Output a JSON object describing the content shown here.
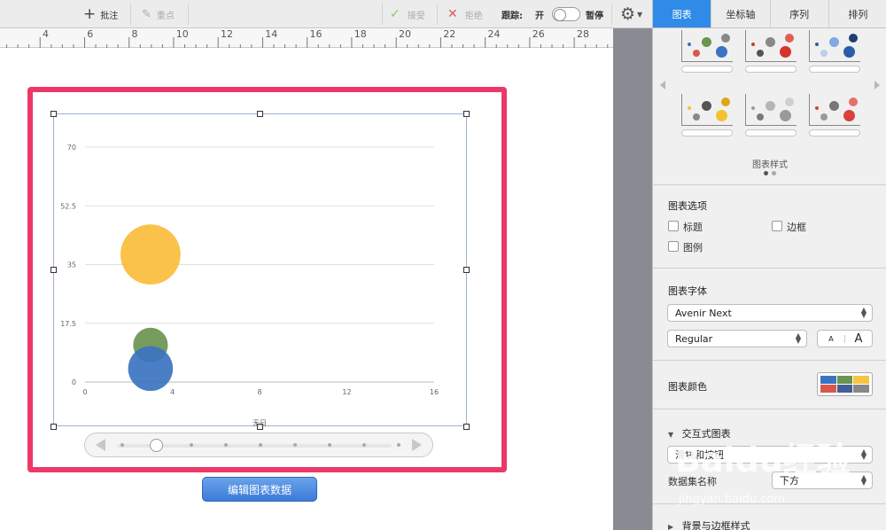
{
  "toolbar": {
    "comment_label": "批注",
    "highlight_label": "重点",
    "accept_label": "接受",
    "reject_label": "拒绝",
    "track_label": "跟踪:",
    "track_on_label": "开",
    "pause_label": "暂停"
  },
  "ruler": {
    "labels": [
      "4",
      "6",
      "8",
      "10",
      "12",
      "14",
      "16",
      "18",
      "20",
      "22",
      "24",
      "26",
      "28"
    ]
  },
  "chart_data": {
    "type": "scatter",
    "variant": "bubble",
    "xlabel": "无日",
    "x_ticks": [
      "0",
      "4",
      "8",
      "12",
      "16"
    ],
    "y_ticks": [
      "0",
      "17.5",
      "35",
      "52.5",
      "70"
    ],
    "xlim": [
      0,
      16
    ],
    "ylim": [
      0,
      70
    ],
    "grid": true,
    "legend": "none",
    "series": [
      {
        "color": "#fbbd3c",
        "points": [
          {
            "x": 3,
            "y": 38,
            "size": 9
          }
        ]
      },
      {
        "color": "#6a9450",
        "points": [
          {
            "x": 3,
            "y": 11,
            "size": 3
          }
        ]
      },
      {
        "color": "#3b74c0",
        "points": [
          {
            "x": 3,
            "y": 4,
            "size": 5
          }
        ]
      }
    ]
  },
  "edit_button_label": "编辑图表数据",
  "inspector": {
    "tabs": [
      {
        "label": "图表"
      },
      {
        "label": "坐标轴"
      },
      {
        "label": "序列"
      },
      {
        "label": "排列"
      }
    ],
    "styles_label": "图表样式",
    "options": {
      "title": "图表选项",
      "title_checkbox": "标题",
      "border_checkbox": "边框",
      "legend_checkbox": "图例"
    },
    "font": {
      "title": "图表字体",
      "family": "Avenir Next",
      "weight": "Regular",
      "size_small": "A",
      "size_large": "A"
    },
    "colors": {
      "title": "图表颜色",
      "palette": [
        "#3a73c2",
        "#6a9450",
        "#f5c440",
        "#d9584a",
        "#3f5f96",
        "#888888"
      ]
    },
    "interactive": {
      "title": "交互式图表",
      "mode": "滑块和按钮",
      "data_label": "数据集名称",
      "position": "下方"
    },
    "background": {
      "title": "背景与边框样式"
    }
  },
  "watermark": {
    "brand": "Baidu经验",
    "url": "jingyan.baidu.com"
  }
}
